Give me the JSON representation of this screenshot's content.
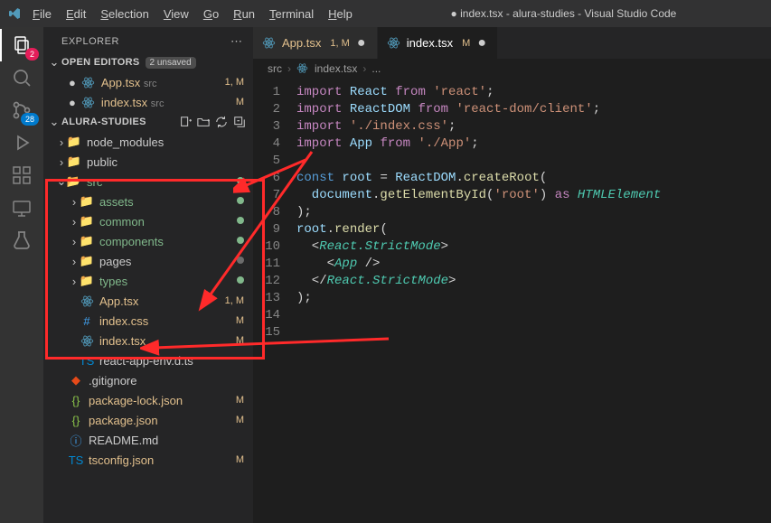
{
  "titlebar": {
    "title": "index.tsx - alura-studies - Visual Studio Code",
    "dirty_prefix": "●"
  },
  "menu": [
    "File",
    "Edit",
    "Selection",
    "View",
    "Go",
    "Run",
    "Terminal",
    "Help"
  ],
  "activity": {
    "explorer_badge": "2",
    "scm_badge": "28"
  },
  "sidebar": {
    "title": "EXPLORER",
    "open_editors_label": "OPEN EDITORS",
    "unsaved_tag": "2 unsaved",
    "project_label": "ALURA-STUDIES"
  },
  "open_editors": [
    {
      "name": "App.tsx",
      "dir": "src",
      "status": "1, M",
      "dirty": true,
      "orange": true
    },
    {
      "name": "index.tsx",
      "dir": "src",
      "status": "M",
      "dirty": true,
      "orange": true
    }
  ],
  "tree": {
    "node_modules": "node_modules",
    "public": "public",
    "src": "src",
    "assets": "assets",
    "common": "common",
    "components": "components",
    "pages": "pages",
    "types": "types",
    "App_tsx": "App.tsx",
    "App_tsx_status": "1, M",
    "index_css": "index.css",
    "index_css_status": "M",
    "index_tsx": "index.tsx",
    "index_tsx_status": "M",
    "react_env": "react-app-env.d.ts",
    "gitignore": ".gitignore",
    "pkg_lock": "package-lock.json",
    "pkg_lock_status": "M",
    "pkg": "package.json",
    "pkg_status": "M",
    "readme": "README.md",
    "tsconfig": "tsconfig.json",
    "tsconfig_status": "M"
  },
  "tabs": [
    {
      "name": "App.tsx",
      "suffix": "1, M",
      "dirty": true,
      "active": false
    },
    {
      "name": "index.tsx",
      "suffix": "M",
      "dirty": true,
      "active": true
    }
  ],
  "breadcrumb": {
    "a": "src",
    "b": "index.tsx",
    "c": "..."
  },
  "code": {
    "l1": {
      "a": "import",
      "b": " React ",
      "c": "from",
      "d": " 'react'",
      "e": ";"
    },
    "l2": {
      "a": "import",
      "b": " ReactDOM ",
      "c": "from",
      "d": " 'react-dom/client'",
      "e": ";"
    },
    "l3": {
      "a": "import",
      "b": " './index.css'",
      "c": ";"
    },
    "l4": {
      "a": "import",
      "b": " App ",
      "c": "from",
      "d": " './App'",
      "e": ";"
    },
    "l6": {
      "a": "const",
      "b": " root ",
      "c": "= ",
      "d": "ReactDOM",
      "e": ".",
      "f": "createRoot",
      "g": "("
    },
    "l7": {
      "a": "  document",
      "b": ".",
      "c": "getElementById",
      "d": "(",
      "e": "'root'",
      "f": ") ",
      "g": "as",
      "h": " HTMLElement"
    },
    "l8": {
      "a": ");"
    },
    "l9": {
      "a": "root",
      "b": ".",
      "c": "render",
      "d": "("
    },
    "l10": {
      "a": "  <",
      "b": "React.StrictMode",
      "c": ">"
    },
    "l11": {
      "a": "    <",
      "b": "App",
      "c": " />"
    },
    "l12": {
      "a": "  </",
      "b": "React.StrictMode",
      "c": ">"
    },
    "l13": {
      "a": ");"
    }
  },
  "line_numbers": [
    1,
    2,
    3,
    4,
    5,
    6,
    7,
    8,
    9,
    10,
    11,
    12,
    13,
    14,
    15
  ]
}
